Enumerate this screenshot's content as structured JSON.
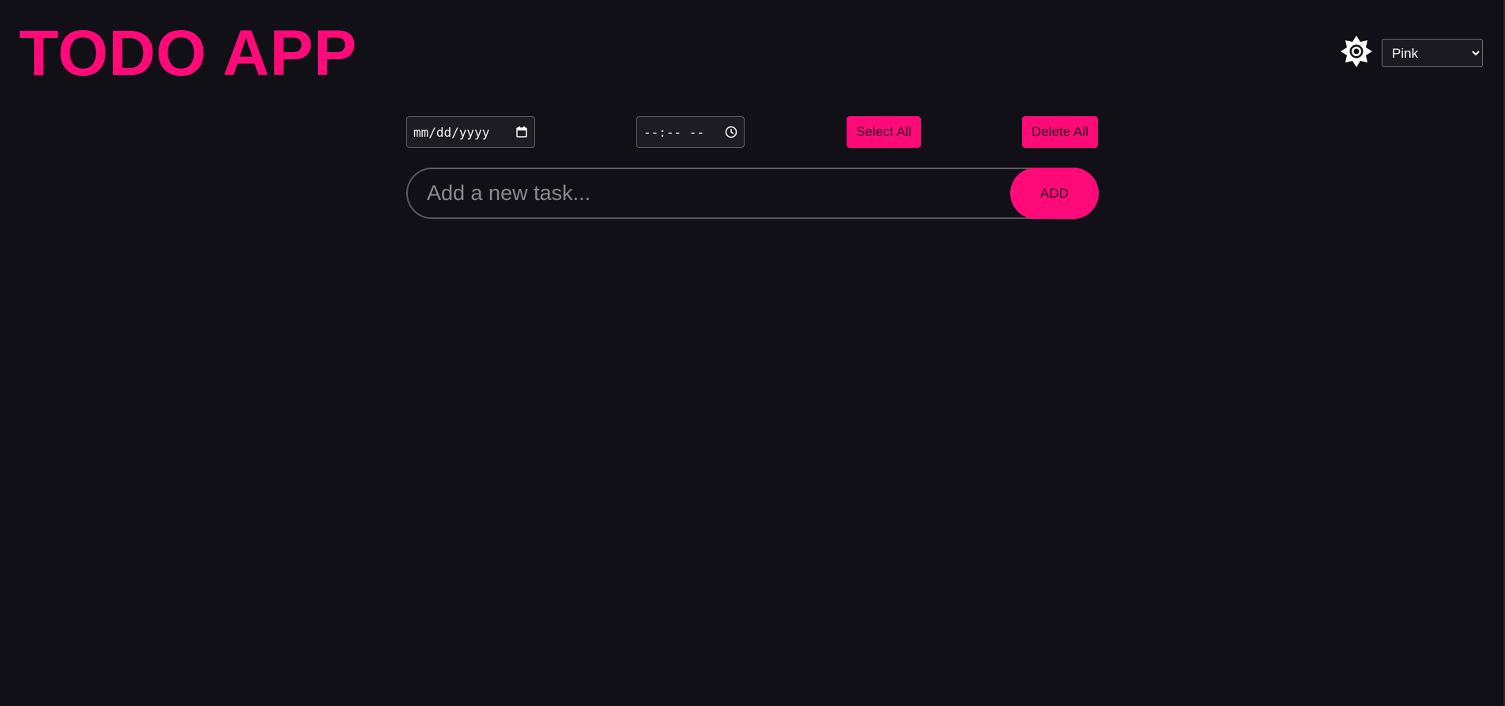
{
  "app": {
    "title": "TODO APP"
  },
  "colors": {
    "accent": "#ff0a78",
    "background": "#111016"
  },
  "header": {
    "theme_icon": "sun-icon",
    "color_select": {
      "selected": "Pink",
      "options": [
        "Pink"
      ]
    }
  },
  "controls": {
    "date_placeholder": "mm/dd/yyyy",
    "date_icon": "calendar-icon",
    "time_placeholder": "--:-- --",
    "time_icon": "clock-icon",
    "select_all_label": "Select All",
    "delete_all_label": "Delete All"
  },
  "task_entry": {
    "placeholder": "Add a new task...",
    "add_label": "ADD"
  }
}
